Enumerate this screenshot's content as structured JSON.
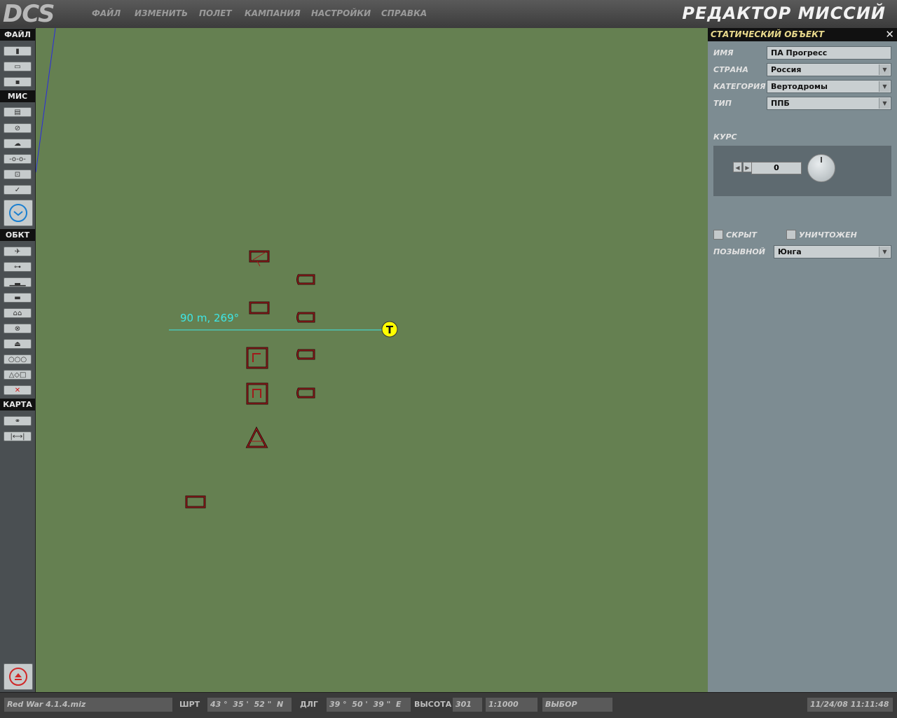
{
  "logo": "DCS",
  "menu": [
    "ФАЙЛ",
    "ИЗМЕНИТЬ",
    "ПОЛЕТ",
    "КАМПАНИЯ",
    "НАСТРОЙКИ",
    "СПРАВКА"
  ],
  "app_title": "РЕДАКТОР МИССИЙ",
  "toolbar": {
    "sections": [
      "ФАЙЛ",
      "МИС",
      "ОБКТ",
      "КАРТА"
    ],
    "file_icons": [
      "new-file-icon",
      "open-folder-icon",
      "save-icon"
    ],
    "mission_icons": [
      "briefing-icon",
      "no-entry-icon",
      "weather-icon",
      "trigger-icon",
      "zone-icon",
      "check-icon",
      "clock-icon"
    ],
    "object_icons": [
      "airplane-icon",
      "helicopter-icon",
      "ship-icon",
      "tank-icon",
      "static-object-icon",
      "target-icon",
      "mine-icon",
      "template-icon",
      "shapes-icon",
      "delete-icon"
    ],
    "map_icons": [
      "binoculars-icon",
      "ruler-icon"
    ],
    "bottom_icon": "eject-icon"
  },
  "map": {
    "measure_label": "90 m, 269°",
    "center_marker_label": "Т",
    "colors": {
      "ground": "#658051",
      "objects": "#8b1a1a",
      "measure": "#3ee6e6",
      "marker": "#ffff00"
    }
  },
  "panel": {
    "title": "СТАТИЧЕСКИЙ ОБЪЕКТ",
    "close_symbol": "✕",
    "name_label": "ИМЯ",
    "name_value": "ПА Прогресс",
    "country_label": "СТРАНА",
    "country_value": "Россия",
    "category_label": "КАТЕГОРИЯ",
    "category_value": "Вертодромы",
    "type_label": "ТИП",
    "type_value": "ППБ",
    "heading_label": "КУРС",
    "heading_value": "0",
    "hidden_label": "СКРЫТ",
    "hidden_checked": false,
    "destroyed_label": "УНИЧТОЖЕН",
    "destroyed_checked": false,
    "callsign_label": "ПОЗЫВНОЙ",
    "callsign_value": "Юнга"
  },
  "status": {
    "file": "Red War 4.1.4.miz",
    "lat_label": "ШРТ",
    "lat_value": "43 °  35 '  52 \"  N",
    "lon_label": "ДЛГ",
    "lon_value": "39 °  50 '  39 \"  E",
    "alt_label": "ВЫСОТА",
    "alt_value": "301",
    "scale": "1:1000",
    "mode": "ВЫБОР",
    "datetime": "11/24/08 11:11:48"
  }
}
